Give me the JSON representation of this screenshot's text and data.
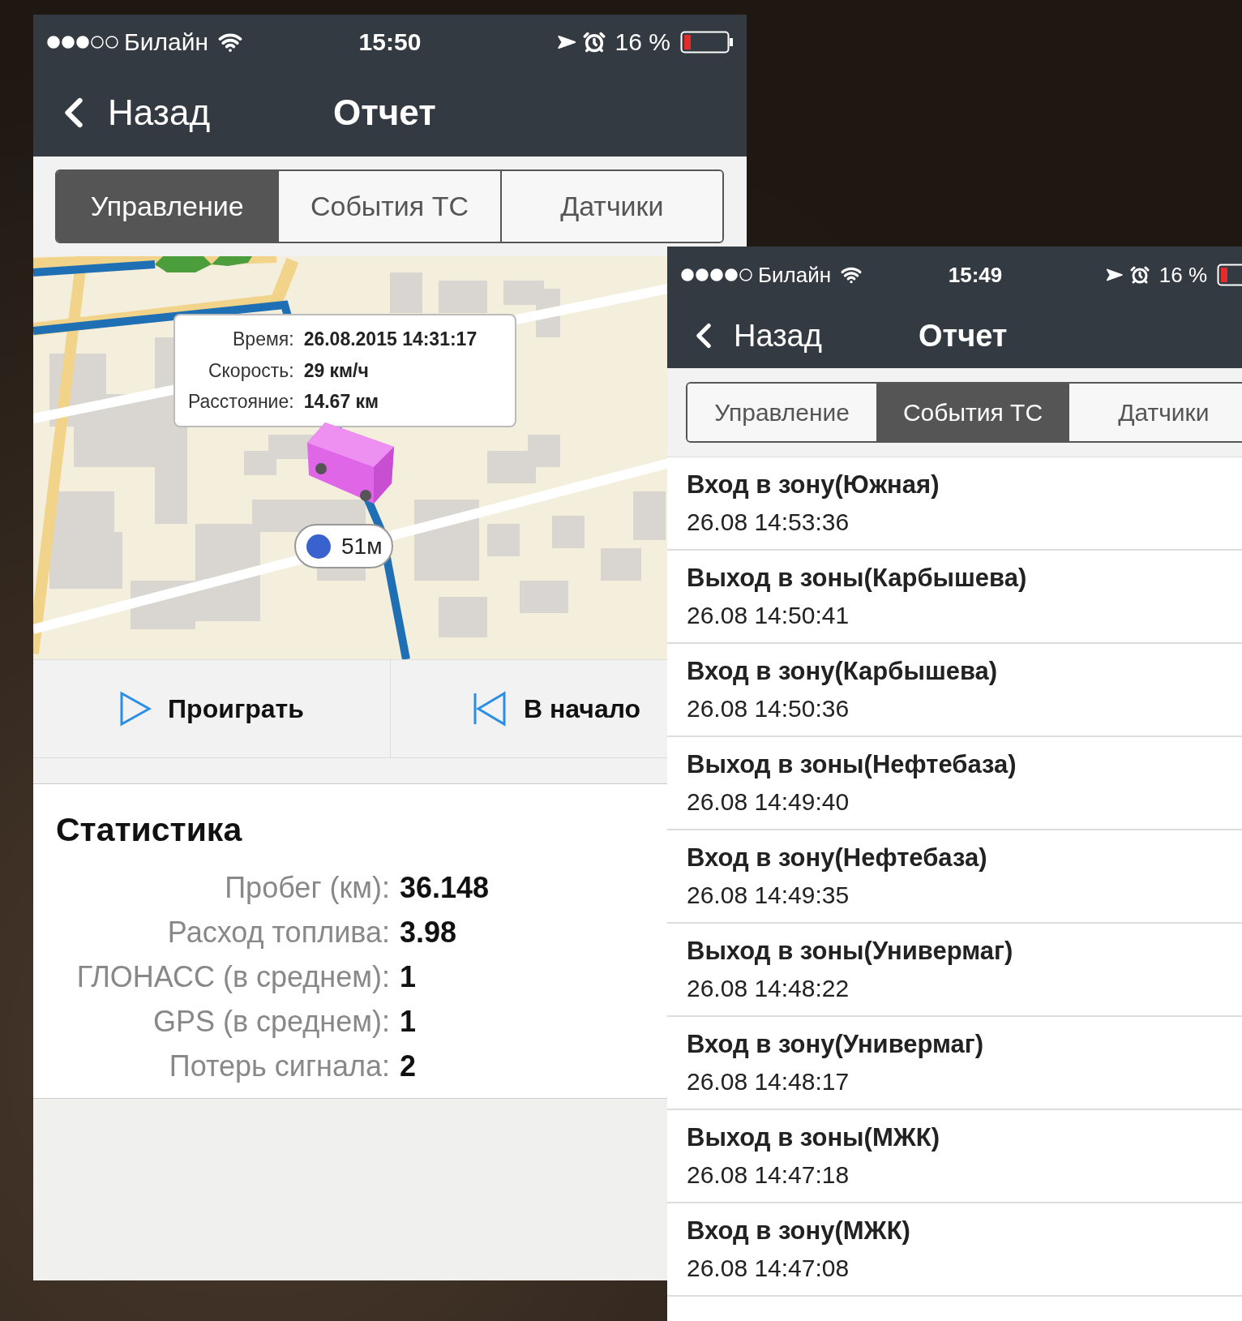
{
  "screens": [
    {
      "status_bar": {
        "carrier": "Билайн",
        "time": "15:50",
        "battery": "16 %"
      },
      "nav": {
        "back": "Назад",
        "title": "Отчет"
      },
      "tabs": [
        {
          "label": "Управление",
          "selected": true
        },
        {
          "label": "События ТС",
          "selected": false
        },
        {
          "label": "Датчики",
          "selected": false
        }
      ],
      "map": {
        "popup": [
          {
            "label": "Время:",
            "value": "26.08.2015 14:31:17"
          },
          {
            "label": "Скорость:",
            "value": "29 км/ч"
          },
          {
            "label": "Расстояние:",
            "value": "14.67 км"
          }
        ],
        "distance": "51м"
      },
      "actions": [
        {
          "kind": "play",
          "label": "Проиграть"
        },
        {
          "kind": "rewind",
          "label": "В начало"
        }
      ],
      "stats": {
        "title": "Статистика",
        "rows": [
          {
            "label": "Пробег (км):",
            "value": "36.148"
          },
          {
            "label": "Расход топлива:",
            "value": "3.98"
          },
          {
            "label": "ГЛОНАСС (в среднем):",
            "value": "1"
          },
          {
            "label": "GPS (в среднем):",
            "value": "1"
          },
          {
            "label": "Потерь сигнала:",
            "value": "2"
          }
        ]
      }
    },
    {
      "status_bar": {
        "carrier": "Билайн",
        "time": "15:49",
        "battery": "16 %"
      },
      "nav": {
        "back": "Назад",
        "title": "Отчет"
      },
      "tabs": [
        {
          "label": "Управление",
          "selected": false
        },
        {
          "label": "События ТС",
          "selected": true
        },
        {
          "label": "Датчики",
          "selected": false
        }
      ],
      "events": [
        {
          "title": "Вход в зону(Южная)",
          "time": "26.08 14:53:36"
        },
        {
          "title": "Выход в зоны(Карбышева)",
          "time": "26.08 14:50:41"
        },
        {
          "title": "Вход в зону(Карбышева)",
          "time": "26.08 14:50:36"
        },
        {
          "title": "Выход в зоны(Нефтебаза)",
          "time": "26.08 14:49:40"
        },
        {
          "title": "Вход в зону(Нефтебаза)",
          "time": "26.08 14:49:35"
        },
        {
          "title": "Выход в зоны(Универмаг)",
          "time": "26.08 14:48:22"
        },
        {
          "title": "Вход в зону(Универмаг)",
          "time": "26.08 14:48:17"
        },
        {
          "title": "Выход в зоны(МЖК)",
          "time": "26.08 14:47:18"
        },
        {
          "title": "Вход в зону(МЖК)",
          "time": "26.08 14:47:08"
        }
      ]
    }
  ]
}
